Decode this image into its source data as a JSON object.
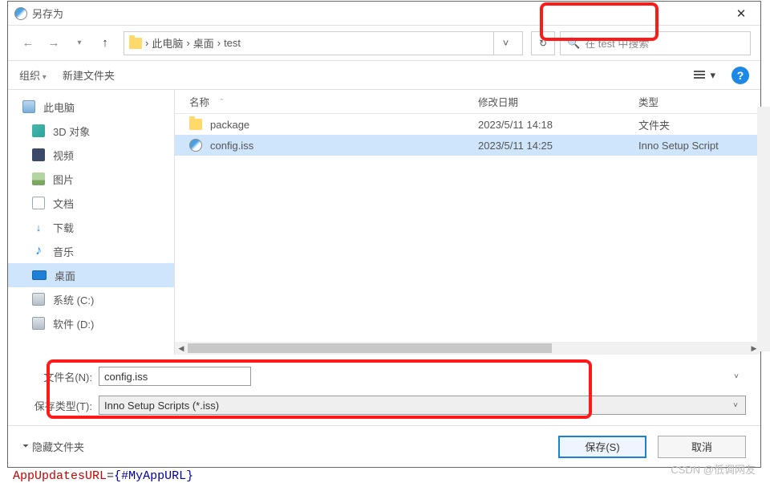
{
  "title": "另存为",
  "breadcrumb": {
    "root": "此电脑",
    "folder": "桌面",
    "current": "test",
    "sep": "›"
  },
  "search": {
    "placeholder": "在 test 中搜索"
  },
  "toolbar": {
    "organize": "组织",
    "newfolder": "新建文件夹"
  },
  "sidebar": {
    "items": [
      {
        "label": "此电脑",
        "icon": "pc",
        "level": 0
      },
      {
        "label": "3D 对象",
        "icon": "cube"
      },
      {
        "label": "视频",
        "icon": "film"
      },
      {
        "label": "图片",
        "icon": "pic"
      },
      {
        "label": "文档",
        "icon": "doc"
      },
      {
        "label": "下载",
        "icon": "dl",
        "glyph": "↓"
      },
      {
        "label": "音乐",
        "icon": "music",
        "glyph": "♪"
      },
      {
        "label": "桌面",
        "icon": "desk",
        "selected": true
      },
      {
        "label": "系统 (C:)",
        "icon": "disk"
      },
      {
        "label": "软件 (D:)",
        "icon": "disk"
      }
    ]
  },
  "columns": {
    "name": "名称",
    "date": "修改日期",
    "type": "类型"
  },
  "rows": [
    {
      "name": "package",
      "date": "2023/5/11 14:18",
      "type": "文件夹",
      "kind": "folder"
    },
    {
      "name": "config.iss",
      "date": "2023/5/11 14:25",
      "type": "Inno Setup Script",
      "kind": "iss",
      "selected": true
    }
  ],
  "form": {
    "filename_label": "文件名(N):",
    "filename_value": "config.iss",
    "filetype_label": "保存类型(T):",
    "filetype_value": "Inno Setup Scripts (*.iss)"
  },
  "footer": {
    "hide": "隐藏文件夹",
    "save": "保存(S)",
    "cancel": "取消"
  },
  "watermark": "CSDN @低调网友",
  "behind": {
    "a": "AppUpdatesURL",
    "eq": "=",
    "b1": "{",
    "b2": "#MyAppURL",
    "b3": "}"
  }
}
